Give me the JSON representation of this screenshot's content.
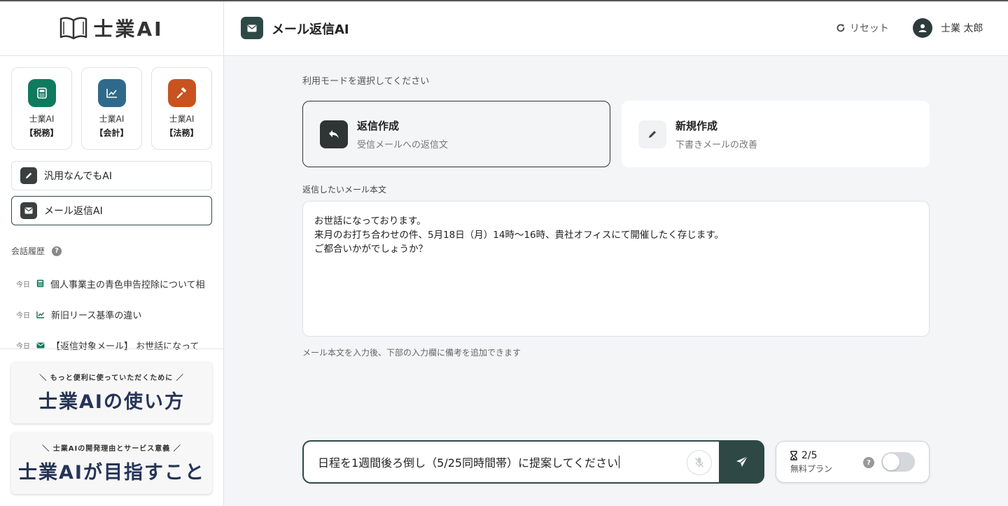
{
  "brand": {
    "name": "士業AI"
  },
  "sidebar": {
    "tools": [
      {
        "name": "士業AI",
        "sub": "【税務】",
        "icon": "calculator-icon",
        "color": "#0f7a5d"
      },
      {
        "name": "士業AI",
        "sub": "【会計】",
        "icon": "chart-line-icon",
        "color": "#2f6a8a"
      },
      {
        "name": "士業AI",
        "sub": "【法務】",
        "icon": "gavel-icon",
        "color": "#c8531f"
      }
    ],
    "nav": [
      {
        "label": "汎用なんでもAI",
        "icon": "pencil-icon"
      },
      {
        "label": "メール返信AI",
        "icon": "envelope-icon",
        "active": true
      }
    ],
    "history_title": "会話履歴",
    "history": [
      {
        "day": "今日",
        "icon": "calculator-icon",
        "title": "個人事業主の青色申告控除について相"
      },
      {
        "day": "今日",
        "icon": "chart-line-icon",
        "title": "新旧リース基準の違い"
      },
      {
        "day": "今日",
        "icon": "envelope-icon",
        "title": "【返信対象メール】 お世話になって"
      }
    ],
    "banners": [
      {
        "sub": "＼ もっと便利に使っていただくために ／",
        "main": "士業AIの使い方"
      },
      {
        "sub": "＼ 士業AIの開発理由とサービス意義 ／",
        "main": "士業AIが目指すこと"
      }
    ]
  },
  "header": {
    "title": "メール返信AI",
    "reset_label": "リセット",
    "user_name": "士業 太郎"
  },
  "main": {
    "mode_label": "利用モードを選択してください",
    "modes": [
      {
        "title": "返信作成",
        "desc": "受信メールへの返信文",
        "active": true
      },
      {
        "title": "新規作成",
        "desc": "下書きメールの改善",
        "active": false
      }
    ],
    "mail_label": "返信したいメール本文",
    "mail_lines": [
      "お世話になっております。",
      "来月のお打ち合わせの件、5月18日（月）14時〜16時、貴社オフィスにて開催したく存じます。",
      "ご都合いかがでしょうか？"
    ],
    "mail_hint": "メール本文を入力後、下部の入力欄に備考を追加できます",
    "chat_input": "日程を1週間後ろ倒し（5/25同時間帯）に提案してください",
    "usage": {
      "count": "2/5",
      "plan": "無料プラン",
      "toggle_on": false
    }
  },
  "colors": {
    "accent": "#2e4845"
  }
}
